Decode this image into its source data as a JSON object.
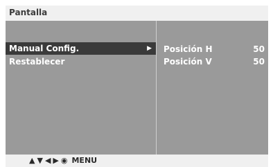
{
  "title": "Pantalla",
  "menu": {
    "items": [
      {
        "label": "Manual Config.",
        "selected": true,
        "arrow_icon": "right-triangle-icon"
      },
      {
        "label": "Restablecer",
        "selected": false
      }
    ]
  },
  "params": [
    {
      "label": "Posición H",
      "value": "50"
    },
    {
      "label": "Posición V",
      "value": "50"
    }
  ],
  "footer": {
    "icons": [
      "up-triangle-icon",
      "down-triangle-icon",
      "left-triangle-icon",
      "right-triangle-icon",
      "ok-circle-icon"
    ],
    "menu_label": "MENU"
  },
  "colors": {
    "panel": "#9a9a9a",
    "selected": "#3a3a3a",
    "titlebar": "#f0f0f0"
  }
}
